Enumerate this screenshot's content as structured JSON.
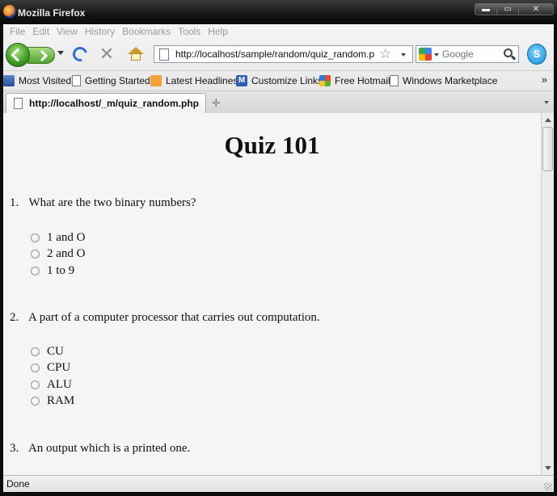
{
  "window": {
    "title": "Mozilla Firefox",
    "controls": {
      "minimize": "▬",
      "maximize": "▭",
      "close": "✕"
    }
  },
  "menu": [
    "File",
    "Edit",
    "View",
    "History",
    "Bookmarks",
    "Tools",
    "Help"
  ],
  "navigation": {
    "url": "http://localhost/sample/random/quiz_random.php",
    "search_placeholder": "Google",
    "stop_glyph": "✕",
    "star_glyph": "☆",
    "skype_glyph": "S"
  },
  "bookmarks": {
    "items": [
      {
        "label": "Most Visited",
        "icon": "most-visited-icon"
      },
      {
        "label": "Getting Started",
        "icon": "page-icon"
      },
      {
        "label": "Latest Headlines",
        "icon": "rss-icon"
      },
      {
        "label": "Customize Links",
        "icon": "m-icon",
        "glyph": "M"
      },
      {
        "label": "Free Hotmail",
        "icon": "windows-icon"
      },
      {
        "label": "Windows Marketplace",
        "icon": "page-icon"
      }
    ],
    "more": "»"
  },
  "tabs": {
    "active": "http://localhost/_m/quiz_random.php",
    "new_tab_glyph": "✛"
  },
  "page": {
    "title": "Quiz 101",
    "questions": [
      {
        "number": "1.",
        "text": "What are the two binary numbers?",
        "options": [
          "1 and O",
          "2 and O",
          "1 to 9"
        ]
      },
      {
        "number": "2.",
        "text": "A part of a computer processor that carries out computation.",
        "options": [
          "CU",
          "CPU",
          "ALU",
          "RAM"
        ]
      },
      {
        "number": "3.",
        "text": "An output which is a printed one.",
        "options": []
      }
    ]
  },
  "status": "Done",
  "colors": {
    "titlebar": "#151515",
    "content_bg": "#f5f5f5",
    "accent_green": "#3d9a23",
    "reload_blue": "#2f6fd0"
  }
}
